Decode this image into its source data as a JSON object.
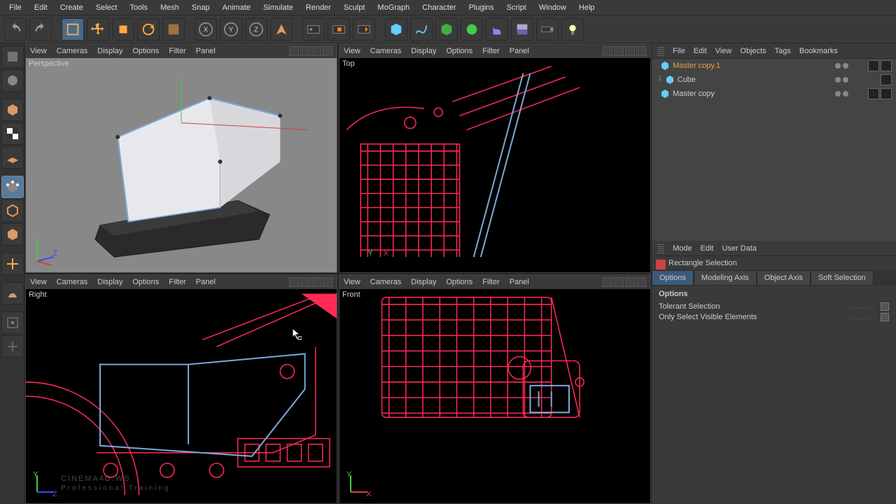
{
  "menu": [
    "File",
    "Edit",
    "Create",
    "Select",
    "Tools",
    "Mesh",
    "Snap",
    "Animate",
    "Simulate",
    "Render",
    "Sculpt",
    "MoGraph",
    "Character",
    "Plugins",
    "Script",
    "Window",
    "Help"
  ],
  "viewport_menu": [
    "View",
    "Cameras",
    "Display",
    "Options",
    "Filter",
    "Panel"
  ],
  "viewports": {
    "tl": "Perspective",
    "tr": "Top",
    "bl": "Right",
    "br": "Front"
  },
  "object_panel_menu": [
    "File",
    "Edit",
    "View",
    "Objects",
    "Tags",
    "Bookmarks"
  ],
  "objects": [
    {
      "name": "Master copy.1",
      "selected": true,
      "indent": 0,
      "icon": "poly",
      "tags": 2
    },
    {
      "name": "Cube",
      "selected": false,
      "indent": 1,
      "icon": "cube",
      "tags": 1
    },
    {
      "name": "Master copy",
      "selected": false,
      "indent": 0,
      "icon": "poly",
      "tags": 2
    }
  ],
  "attr_panel_menu": [
    "Mode",
    "Edit",
    "User Data"
  ],
  "attr_title": "Rectangle Selection",
  "attr_tabs": [
    "Options",
    "Modeling Axis",
    "Object Axis",
    "Soft Selection"
  ],
  "attr_tab_active": 0,
  "attr_heading": "Options",
  "attr_rows": [
    {
      "label": "Tolerant Selection",
      "checked": false
    },
    {
      "label": "Only Select Visible Elements",
      "checked": false
    }
  ],
  "watermark": {
    "line1": "CINEMA4D.WS",
    "line2": "Professional  Training"
  },
  "colors": {
    "wire": "#ff2a55",
    "wire_sel": "#7aa8d8",
    "accent": "#3a5a7a"
  }
}
